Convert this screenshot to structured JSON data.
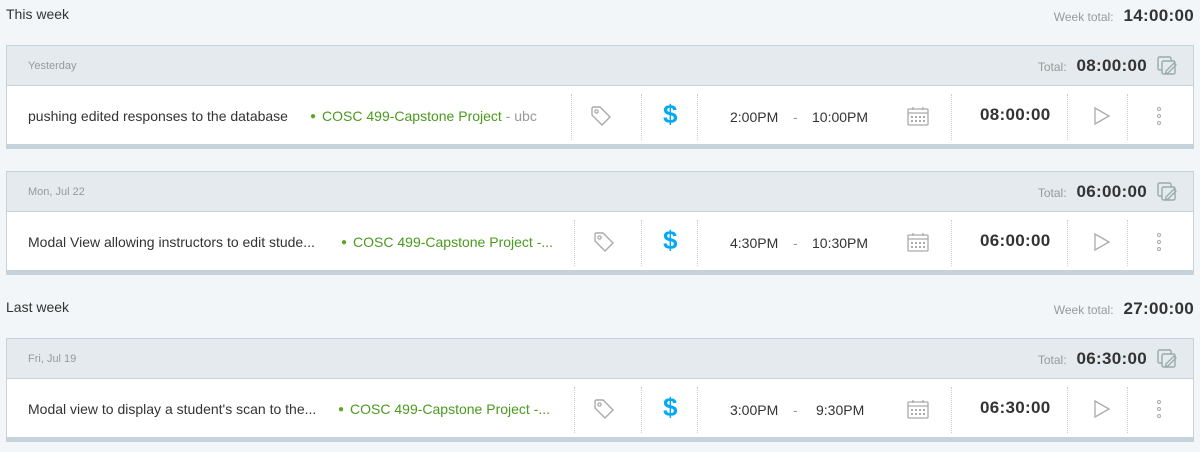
{
  "weeks": [
    {
      "title": "This week",
      "total_label": "Week total:",
      "total": "14:00:00",
      "days": [
        {
          "label": "Yesterday",
          "total_label": "Total:",
          "total": "08:00:00",
          "entries": [
            {
              "description": "pushing edited responses to the database",
              "project": "COSC 499-Capstone Project",
              "client": " - ubc",
              "start": "2:00PM",
              "dash": "-",
              "end": "10:00PM",
              "duration": "08:00:00"
            }
          ]
        },
        {
          "label": "Mon, Jul 22",
          "total_label": "Total:",
          "total": "06:00:00",
          "entries": [
            {
              "description": "Modal View allowing instructors to edit stude...",
              "project": "COSC 499-Capstone Project -...",
              "client": "",
              "start": "4:30PM",
              "dash": "-",
              "end": "10:30PM",
              "duration": "06:00:00"
            }
          ]
        }
      ]
    },
    {
      "title": "Last week",
      "total_label": "Week total:",
      "total": "27:00:00",
      "days": [
        {
          "label": "Fri, Jul 19",
          "total_label": "Total:",
          "total": "06:30:00",
          "entries": [
            {
              "description": "Modal view to display a student's scan to the...",
              "project": "COSC 499-Capstone Project -...",
              "client": "",
              "start": "3:00PM",
              "dash": "-",
              "end": "9:30PM",
              "duration": "06:30:00"
            }
          ]
        }
      ]
    }
  ],
  "icons": {
    "bulk_edit": "bulk-edit-icon",
    "tag": "tag-icon",
    "billable": "$",
    "calendar": "calendar-icon",
    "play": "play-icon",
    "menu": "more-vertical-icon"
  },
  "colors": {
    "project": "#4a9a1e",
    "billable": "#03a9f4",
    "header_bg": "#e4eaee",
    "page_bg": "#f2f6f8"
  }
}
